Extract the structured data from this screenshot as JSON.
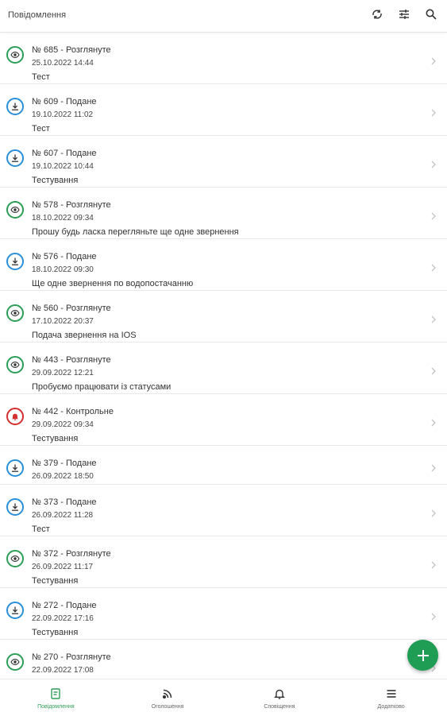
{
  "header": {
    "title": "Повідомлення",
    "icons": [
      "refresh-icon",
      "filter-icon",
      "search-icon"
    ]
  },
  "appeals": [
    {
      "number": "№ 685",
      "status": "Розглянуте",
      "status_type": "viewed",
      "date": "25.10.2022 14:44",
      "description": "Тест"
    },
    {
      "number": "№ 609",
      "status": "Подане",
      "status_type": "submitted",
      "date": "19.10.2022 11:02",
      "description": "Тест"
    },
    {
      "number": "№ 607",
      "status": "Подане",
      "status_type": "submitted",
      "date": "19.10.2022 10:44",
      "description": "Тестування"
    },
    {
      "number": "№ 578",
      "status": "Розглянуте",
      "status_type": "viewed",
      "date": "18.10.2022 09:34",
      "description": "Прошу будь ласка перегляньте ще одне звернення"
    },
    {
      "number": "№ 576",
      "status": "Подане",
      "status_type": "submitted",
      "date": "18.10.2022 09:30",
      "description": "Ще одне звернення по водопостачанню"
    },
    {
      "number": "№ 560",
      "status": "Розглянуте",
      "status_type": "viewed",
      "date": "17.10.2022 20:37",
      "description": "Подача звернення на IOS"
    },
    {
      "number": "№ 443",
      "status": "Розглянуте",
      "status_type": "viewed",
      "date": "29.09.2022 12:21",
      "description": "Пробуємо працювати із статусами"
    },
    {
      "number": "№ 442",
      "status": "Контрольне",
      "status_type": "control",
      "date": "29.09.2022 09:34",
      "description": "Тестування"
    },
    {
      "number": "№ 379",
      "status": "Подане",
      "status_type": "submitted",
      "date": "26.09.2022 18:50",
      "description": ""
    },
    {
      "number": "№ 373",
      "status": "Подане",
      "status_type": "submitted",
      "date": "26.09.2022 11:28",
      "description": "Тест"
    },
    {
      "number": "№ 372",
      "status": "Розглянуте",
      "status_type": "viewed",
      "date": "26.09.2022 11:17",
      "description": "Тестування"
    },
    {
      "number": "№ 272",
      "status": "Подане",
      "status_type": "submitted",
      "date": "22.09.2022 17:16",
      "description": "Тестування"
    },
    {
      "number": "№ 270",
      "status": "Розглянуте",
      "status_type": "viewed",
      "date": "22.09.2022 17:08",
      "description": ""
    }
  ],
  "fab": {
    "icon": "plus-icon"
  },
  "bottom_nav": [
    {
      "key": "messages",
      "label": "Повідомлення",
      "icon": "message-icon",
      "active": true
    },
    {
      "key": "announcements",
      "label": "Оголошення",
      "icon": "rss-icon",
      "active": false
    },
    {
      "key": "notifications",
      "label": "Сповіщення",
      "icon": "bell-icon",
      "active": false
    },
    {
      "key": "more",
      "label": "Додатково",
      "icon": "menu-icon",
      "active": false
    }
  ],
  "colors": {
    "accent": "#1f9d55",
    "viewed": "#2e9e57",
    "submitted": "#2a8fd8",
    "control": "#d32f2f"
  }
}
